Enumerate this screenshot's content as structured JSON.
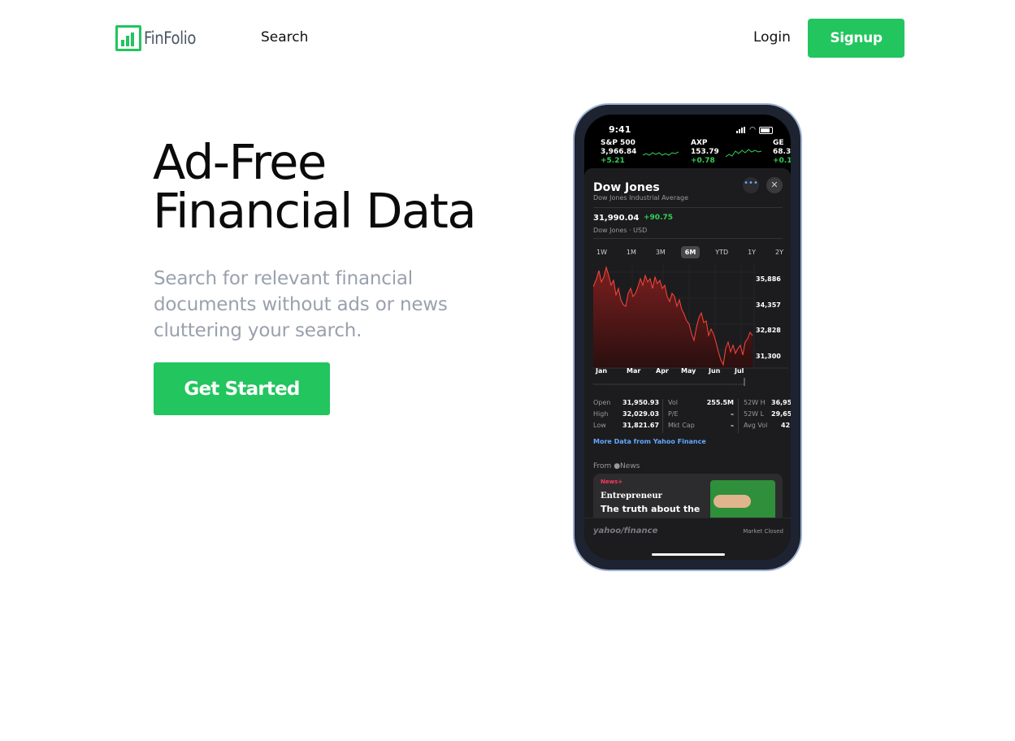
{
  "nav": {
    "brand": "FinFolio",
    "search": "Search",
    "login": "Login",
    "signup": "Signup"
  },
  "hero": {
    "title_line1": "Ad-Free",
    "title_line2": "Financial Data",
    "subtitle": "Search for relevant financial documents without ads or news cluttering your search.",
    "cta": "Get Started"
  },
  "colors": {
    "accent": "#22c55e",
    "title": "#0b0b0b",
    "subtitle": "#9aa1ad"
  },
  "phone": {
    "time": "9:41",
    "tickers": [
      {
        "symbol": "S&P 500",
        "price": "3,966.84",
        "change": "+5.21"
      },
      {
        "symbol": "AXP",
        "price": "153.79",
        "change": "+0.78"
      },
      {
        "symbol": "GE",
        "price": "68.3",
        "change": "+0.1"
      }
    ],
    "card": {
      "title": "Dow Jones",
      "subtitle": "Dow Jones Industrial Average",
      "price": "31,990.04",
      "change": "+90.75",
      "currency": "Dow Jones · USD",
      "ranges": [
        "1W",
        "1M",
        "3M",
        "6M",
        "YTD",
        "1Y",
        "2Y"
      ],
      "active_range": "6M",
      "months": [
        "Jan",
        "Mar",
        "Apr",
        "May",
        "Jun",
        "Jul"
      ],
      "yticks": [
        "35,886",
        "34,357",
        "32,828",
        "31,300"
      ],
      "stats_col1": [
        {
          "k": "Open",
          "v": "31,950.93"
        },
        {
          "k": "High",
          "v": "32,029.03"
        },
        {
          "k": "Low",
          "v": "31,821.67"
        }
      ],
      "stats_col2": [
        {
          "k": "Vol",
          "v": "255.5M"
        },
        {
          "k": "P/E",
          "v": "–"
        },
        {
          "k": "Mkt Cap",
          "v": "–"
        }
      ],
      "stats_col3": [
        {
          "k": "52W H",
          "v": "36,95"
        },
        {
          "k": "52W L",
          "v": "29,65"
        },
        {
          "k": "Avg Vol",
          "v": "42"
        }
      ],
      "more_link": "More Data from Yahoo Finance",
      "from_label": "From",
      "from_source": "News",
      "news_tag": "News+",
      "news_source": "Entrepreneur",
      "news_headline": "The truth about the",
      "footer_brand": "yahoo/finance",
      "market_status": "Market Closed"
    }
  }
}
